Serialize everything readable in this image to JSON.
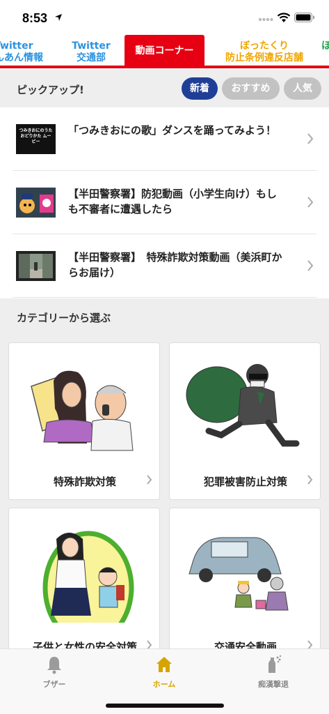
{
  "status": {
    "time": "8:53"
  },
  "tabs": [
    {
      "line1": "Twitter",
      "line2": "んあん情報"
    },
    {
      "line1": "Twitter",
      "line2": "交通部"
    },
    {
      "line1": "動画コーナー"
    },
    {
      "line1": "ぼったくり",
      "line2": "防止条例違反店舗"
    },
    {
      "line1": "ほ"
    }
  ],
  "pickup": {
    "title": "ピックアップ!",
    "filters": [
      "新着",
      "おすすめ",
      "人気"
    ]
  },
  "videos": [
    {
      "title": "「つみきおにの歌」ダンスを踊ってみよう！",
      "thumb_text": "つみきおにのうた おどりかた ムービー"
    },
    {
      "title": "【半田警察署】防犯動画（小学生向け）もしも不審者に遭遇したら"
    },
    {
      "title": "【半田警察署】　特殊詐欺対策動画（美浜町からお届け）"
    }
  ],
  "categories": {
    "title": "カテゴリーから選ぶ",
    "items": [
      {
        "label": "特殊詐欺対策"
      },
      {
        "label": "犯罪被害防止対策"
      },
      {
        "label": "子供と女性の安全対策"
      },
      {
        "label": "交通安全動画"
      }
    ]
  },
  "bottom_nav": [
    {
      "label": "ブザー",
      "icon": "bell-icon"
    },
    {
      "label": "ホーム",
      "icon": "home-icon"
    },
    {
      "label": "痴漢撃退",
      "icon": "spray-icon"
    }
  ],
  "colors": {
    "accent_red": "#e60012",
    "twitter_blue": "#2b93e0",
    "active_pill": "#1f3f96",
    "home_gold": "#d6a400"
  }
}
